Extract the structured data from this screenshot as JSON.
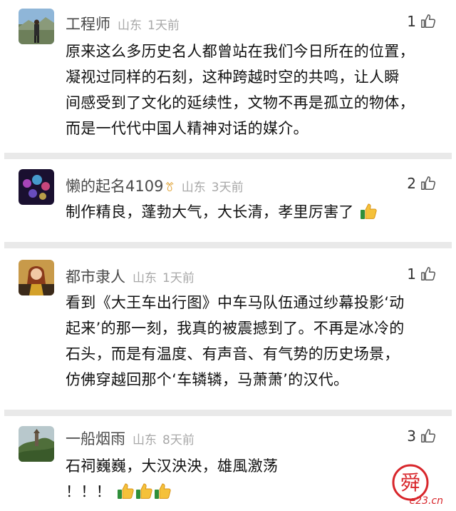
{
  "comments": [
    {
      "username": "工程师",
      "location": "山东",
      "time": "1天前",
      "likes": "1",
      "avatar": "mountain-person-avatar",
      "lines": [
        "原来这么多历史名人都曾站在我们今日所在的位置，",
        "凝视过同样的石刻，这种跨越时空的共鸣，让人瞬",
        "间感受到了文化的延续性，文物不再是孤立的物体，",
        "而是一代代中国人精神对话的媒介。"
      ]
    },
    {
      "username": "懒的起名4109",
      "badge": "ꔢ",
      "location": "山东",
      "time": "3天前",
      "likes": "2",
      "avatar": "night-lights-avatar",
      "text": "制作精良，蓬勃大气，大长清，孝里厉害了",
      "emoji_count": 1
    },
    {
      "username": "都市隶人",
      "location": "山东",
      "time": "1天前",
      "likes": "1",
      "avatar": "cartoon-woman-avatar",
      "lines": [
        "看到《大王车出行图》中车马队伍通过纱幕投影‘动",
        "起来’的那一刻，我真的被震撼到了。不再是冰冷的",
        "石头，而是有温度、有声音、有气势的历史场景，",
        "仿佛穿越回那个‘车辚辚，马萧萧’的汉代。"
      ]
    },
    {
      "username": "一船烟雨",
      "location": "山东",
      "time": "8天前",
      "likes": "3",
      "avatar": "pagoda-landscape-avatar",
      "line1": "石祠巍巍，大汉泱泱，雄風激荡",
      "line2": "！！！",
      "emoji_count": 3
    }
  ],
  "watermark": {
    "char": "舜",
    "site": "e23.cn",
    "color": "#d8262b"
  },
  "icons": {
    "like": "thumbs-up-outline-icon",
    "emoji": "thumbs-up-emoji"
  }
}
